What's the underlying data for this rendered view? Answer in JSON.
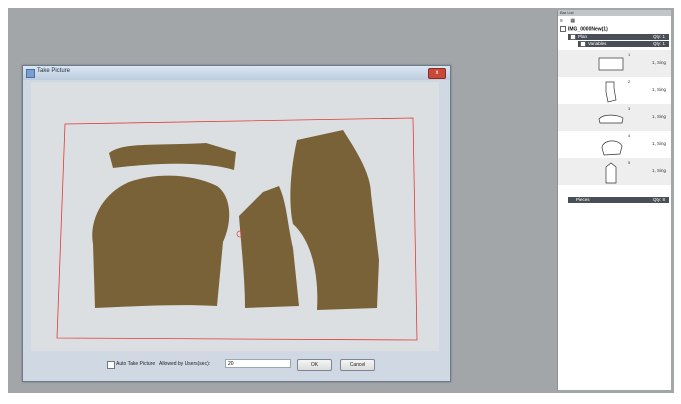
{
  "dialog": {
    "title": "Take Picture",
    "close_glyph": "x",
    "auto_take_label": "Auto Take Picture",
    "allowed_label": "Allowed by Users(sec):",
    "allowed_value": "20",
    "ok_label": "OK",
    "cancel_label": "Cancel"
  },
  "panel": {
    "header": "Bar List",
    "tool_icons": [
      "list-icon",
      "grid-icon"
    ],
    "root_label": "IMG_0000New(1)",
    "group_label": "Plan",
    "group_qty": "Qty: 1",
    "subgroup_label": "Variables",
    "subgroup_qty": "Qty: 1",
    "pieces": [
      {
        "num": "1",
        "desc": "1, Sing"
      },
      {
        "num": "2",
        "desc": "1, Sing"
      },
      {
        "num": "3",
        "desc": "1, Sing"
      },
      {
        "num": "4",
        "desc": "1, Sing"
      },
      {
        "num": "5",
        "desc": "1, Sing"
      }
    ],
    "footer_label": "Pieces",
    "footer_qty": "Qty: 8"
  },
  "colors": {
    "workspace": "#a3a6a9",
    "fabric": "#7a6238",
    "outline": "#e23a3a",
    "tree_highlight": "#4a4f57"
  }
}
